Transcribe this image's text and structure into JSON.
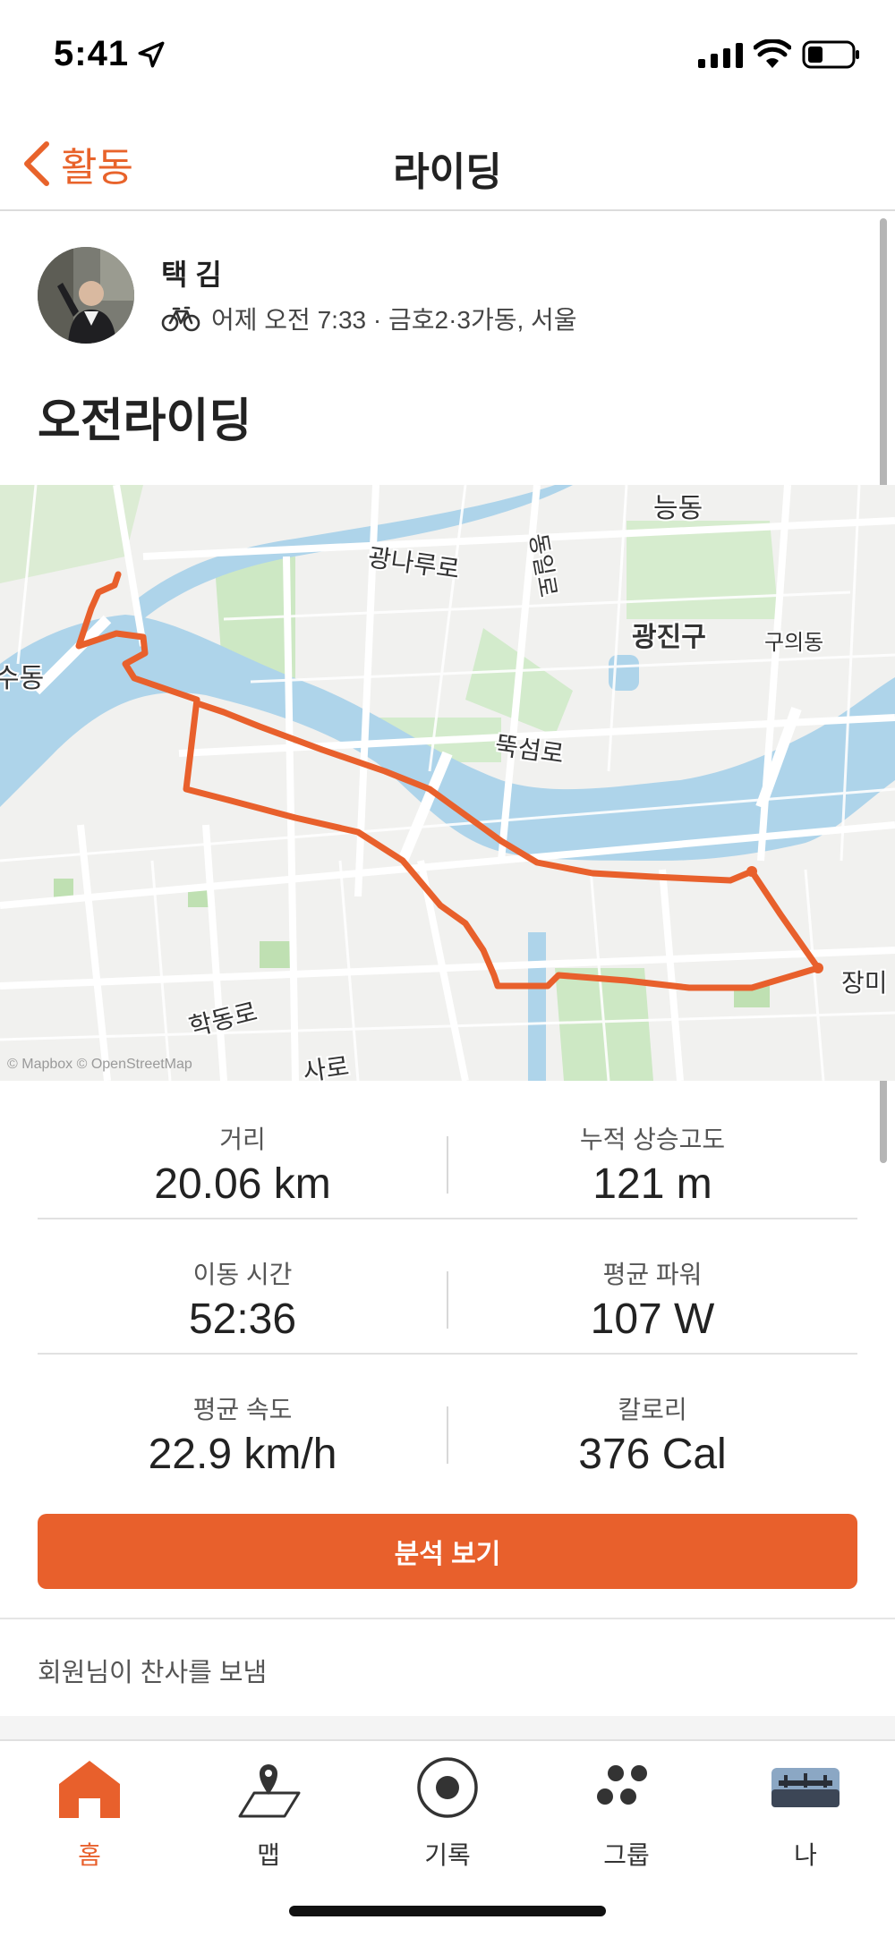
{
  "status_bar": {
    "time": "5:41"
  },
  "nav": {
    "back_label": "활동",
    "title": "라이딩"
  },
  "activity": {
    "athlete_name": "택 김",
    "meta": "어제 오전 7:33 · 금호2·3가동, 서울",
    "title": "오전라이딩"
  },
  "map": {
    "labels": {
      "neungdong": "능동",
      "gwangnaru": "광나루로",
      "dongil": "동일로",
      "gwangjin": "광진구",
      "guui": "구의동",
      "sudong": "수동",
      "ttukseom": "뚝섬로",
      "hakdong": "학동로",
      "jangmi": "장미",
      "road_partial": "사로"
    },
    "attribution": "© Mapbox © OpenStreetMap",
    "route_color": "#e8602c",
    "water_color": "#aed4ea",
    "park_color": "#cde8c4"
  },
  "stats": [
    {
      "left": {
        "label": "거리",
        "value": "20.06 km"
      },
      "right": {
        "label": "누적 상승고도",
        "value": "121 m"
      }
    },
    {
      "left": {
        "label": "이동 시간",
        "value": "52:36"
      },
      "right": {
        "label": "평균 파워",
        "value": "107 W"
      }
    },
    {
      "left": {
        "label": "평균 속도",
        "value": "22.9 km/h"
      },
      "right": {
        "label": "칼로리",
        "value": "376 Cal"
      }
    }
  ],
  "analysis_button": "분석 보기",
  "kudos_text": "회원님이 찬사를 보냄",
  "tabs": [
    {
      "label": "홈",
      "icon": "home-icon",
      "active": true
    },
    {
      "label": "맵",
      "icon": "map-icon",
      "active": false
    },
    {
      "label": "기록",
      "icon": "record-icon",
      "active": false
    },
    {
      "label": "그룹",
      "icon": "groups-icon",
      "active": false
    },
    {
      "label": "나",
      "icon": "profile-icon",
      "active": false
    }
  ],
  "colors": {
    "accent": "#e8602c"
  }
}
